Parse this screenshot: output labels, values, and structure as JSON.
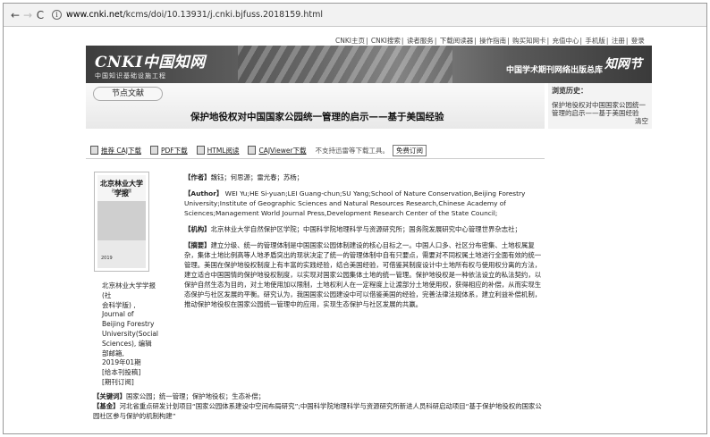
{
  "browser": {
    "back": "←",
    "forward": "→",
    "reload": "C",
    "url_host": "www.cnki.net",
    "url_path": "/kcms/doi/10.13931/j.cnki.bjfuss.2018159.html"
  },
  "site": {
    "top_nav": [
      "CNKI主页",
      "CNKI搜索",
      "读者服务",
      "下载阅读器",
      "操作指南",
      "购买知网卡",
      "充值中心",
      "手机版",
      "注册",
      "登录"
    ],
    "logo_text": "CNKI中国知网",
    "logo_sub": "中国知识基础设施工程",
    "banner_slogan": "中国学术期刊网络出版总库",
    "banner_mark": "知网节",
    "section_tab": "节点文献",
    "history_title": "浏览历史：",
    "history_item": "保护地役权对中国国家公园统一管理的启示——基于美国经验",
    "history_clear": "清空"
  },
  "article": {
    "title": "保护地役权对中国国家公园统一管理的启示——基于美国经验",
    "toolbar": {
      "caj_label": "推荐 CAJ下载",
      "pdf_label": "PDF下载",
      "html_label": "HTML阅读",
      "cajviewer_label": "CAJViewer下载",
      "tip": "不支持迅雷等下载工具。",
      "free_label": "免费订阅"
    },
    "authors_label": "【作者】",
    "authors": "魏钰；何思源；雷光春；苏杨；",
    "author_en_label": "【Author】",
    "author_en": "WEI Yu;HE Si-yuan;LEI Guang-chun;SU Yang;School of Nature Conservation,Beijing Forestry University;Institute of Geographic Sciences and Natural Resources Research,Chinese Academy of Sciences;Management World Journal Press,Development Research Center of the State Council;",
    "institution_label": "【机构】",
    "institution": "北京林业大学自然保护区学院；中国科学院地理科学与资源研究所；国务院发展研究中心管理世界杂志社；",
    "abstract_label": "【摘要】",
    "abstract": "建立分级、统一的管理体制是中国国家公园体制建设的核心目标之一。中国人口多、社区分布密集、土地权属复杂，集体土地比例高等人地矛盾突出的现状决定了统一的管理体制中自有只要点，需要对不同权属土地进行全面有效的统一管理。美国在保护地役权制度上有丰富的实践经验，结合美国经验，可借鉴其制度设计中土地所有权与使用权分离的方法，建立适合中国国情的保护地役权制度，以实现对国家公园集体土地的统一管理。保护地役权是一种依法设立的私法契约，以保护自然生态为目的，对土地使用加以限制，土地权利人在一定程度上让渡部分土地使用权，获得相应的补偿，从而实现生态保护与社区发展的平衡。研究认为，我国国家公园建设中可以借鉴美国的经验，完善法律法规体系，建立利益补偿机制，推动保护地役权在国家公园统一管理中的应用，实现生态保护与社区发展的共赢。",
    "keywords_label": "【关键词】",
    "keywords": "国家公园；统一管理；保护地役权；生态补偿；",
    "fund_label": "【基金】",
    "fund": "河北省重点研发计划项目“国家公园体系建设中空间布局研究”;中国科学院地理科学与资源研究所新进人员科研启动项目“基于保护地役权的国家公园社区参与保护的机制构建”"
  },
  "journal": {
    "cover_title": "北京林业大学学报",
    "cover_sub": "社会科学版",
    "cover_year": "2019",
    "info_lines": [
      "北京林业大学学报(社",
      "会科学版) , Journal of",
      "Beijing Forestry",
      "University(Social",
      "Sciences), 编辑部邮箱,",
      "2019年01期",
      "[给本刊投稿]",
      "[期刊订阅]"
    ]
  }
}
